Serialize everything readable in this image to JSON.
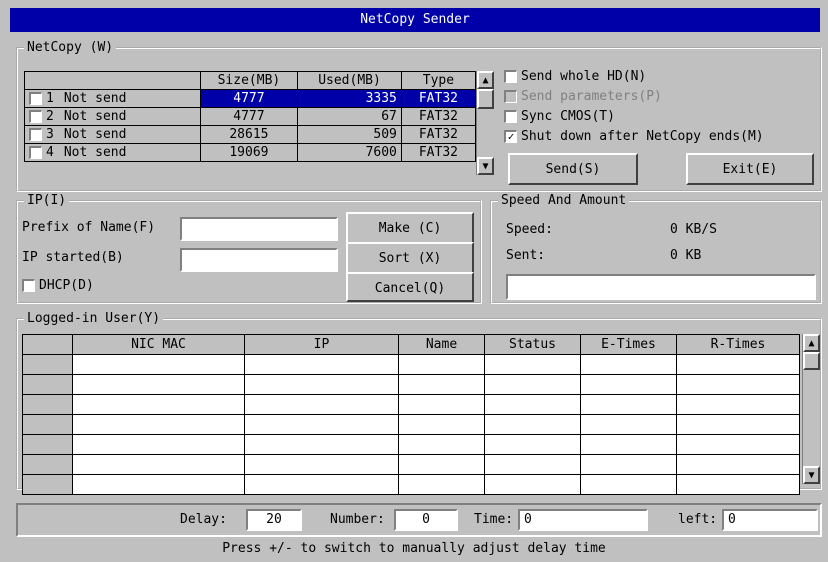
{
  "window": {
    "title": "NetCopy Sender"
  },
  "netcopy": {
    "label": "NetCopy (W)",
    "columns": [
      "",
      "Size(MB)",
      "Used(MB)",
      "Type"
    ],
    "rows": [
      {
        "num": "1",
        "status": "Not send",
        "size": "4777",
        "used": "3335",
        "type": "FAT32"
      },
      {
        "num": "2",
        "status": "Not send",
        "size": "4777",
        "used": "67",
        "type": "FAT32"
      },
      {
        "num": "3",
        "status": "Not send",
        "size": "28615",
        "used": "509",
        "type": "FAT32"
      },
      {
        "num": "4",
        "status": "Not send",
        "size": "19069",
        "used": "7600",
        "type": "FAT32"
      }
    ],
    "options": {
      "send_whole_hd": "Send whole HD(N)",
      "send_parameters": "Send parameters(P)",
      "sync_cmos": "Sync CMOS(T)",
      "shutdown": "Shut down after NetCopy ends(M)"
    },
    "send_label": "Send(S)",
    "exit_label": "Exit(E)"
  },
  "ip": {
    "label": "IP(I)",
    "prefix_label": "Prefix of Name(F)",
    "ip_started_label": "IP started(B)",
    "dhcp_label": "DHCP(D)",
    "make_label": "Make (C)",
    "sort_label": "Sort (X)",
    "cancel_label": "Cancel(Q)"
  },
  "speed": {
    "label": "Speed And Amount",
    "speed_label": "Speed:",
    "speed_value": "0 KB/S",
    "sent_label": "Sent:",
    "sent_value": "0 KB"
  },
  "logged": {
    "label": "Logged-in User(Y)",
    "columns": [
      "",
      "NIC MAC",
      "IP",
      "Name",
      "Status",
      "E-Times",
      "R-Times"
    ]
  },
  "footer": {
    "delay_label": "Delay:",
    "delay_value": "20",
    "number_label": "Number:",
    "number_value": "0",
    "time_label": "Time:",
    "time_value": "0",
    "left_label": "left:",
    "left_value": "0",
    "hint": "Press +/- to switch to manually adjust delay time"
  }
}
